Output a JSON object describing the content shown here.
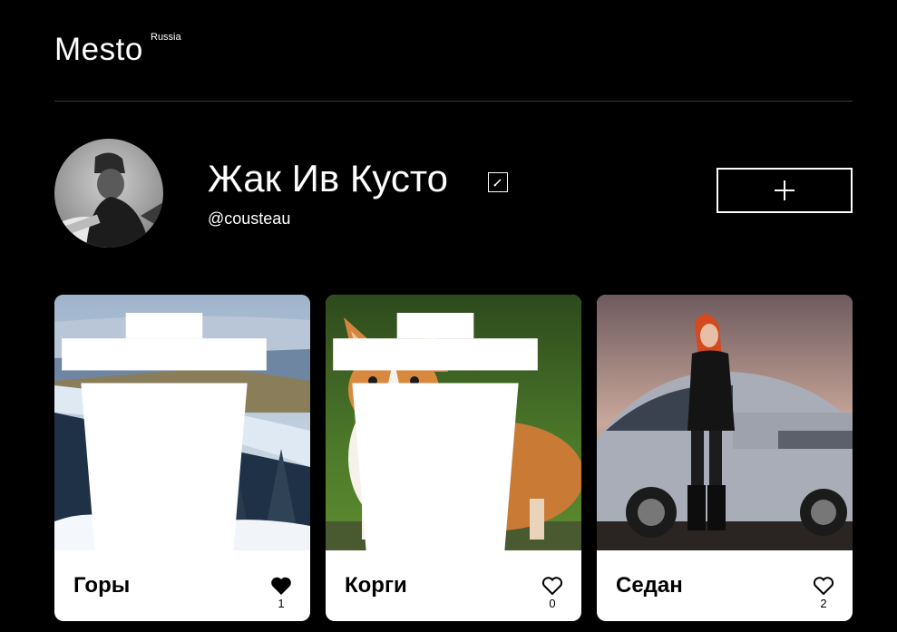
{
  "header": {
    "logo": "Mesto",
    "logo_sup": "Russia"
  },
  "profile": {
    "name": "Жак Ив Кусто",
    "about": "@cousteau"
  },
  "cards": [
    {
      "title": "Горы",
      "likes": "1",
      "liked": true,
      "deletable": true
    },
    {
      "title": "Корги",
      "likes": "0",
      "liked": false,
      "deletable": true
    },
    {
      "title": "Седан",
      "likes": "2",
      "liked": false,
      "deletable": false
    }
  ],
  "colors": {
    "background": "#000000",
    "card": "#ffffff",
    "divider": "#545454"
  },
  "icons": {
    "edit": "pencil-icon",
    "add": "plus-icon",
    "delete": "trash-icon",
    "like": "heart-icon"
  }
}
